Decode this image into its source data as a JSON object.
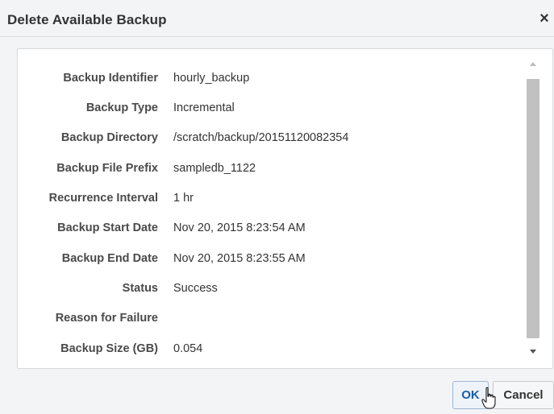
{
  "dialog": {
    "title": "Delete Available Backup",
    "close_glyph": "×"
  },
  "details": [
    {
      "label": "Backup Identifier",
      "value": "hourly_backup"
    },
    {
      "label": "Backup Type",
      "value": "Incremental"
    },
    {
      "label": "Backup Directory",
      "value": "/scratch/backup/20151120082354"
    },
    {
      "label": "Backup File Prefix",
      "value": "sampledb_1122"
    },
    {
      "label": "Recurrence Interval",
      "value": "1 hr"
    },
    {
      "label": "Backup Start Date",
      "value": "Nov 20, 2015 8:23:54 AM"
    },
    {
      "label": "Backup End Date",
      "value": "Nov 20, 2015 8:23:55 AM"
    },
    {
      "label": "Status",
      "value": "Success"
    },
    {
      "label": "Reason for Failure",
      "value": ""
    },
    {
      "label": "Backup Size (GB)",
      "value": "0.054"
    }
  ],
  "buttons": {
    "ok_label": "OK",
    "cancel_label": "Cancel"
  },
  "icons": {
    "close": "close-icon",
    "scroll_up": "chevron-up-icon",
    "scroll_down": "chevron-down-icon",
    "cursor": "hand-pointer-icon"
  },
  "colors": {
    "background": "#f3f4f6",
    "panel": "#ffffff",
    "label_text": "#4a4a4a",
    "ok_text": "#1a5ea8"
  }
}
